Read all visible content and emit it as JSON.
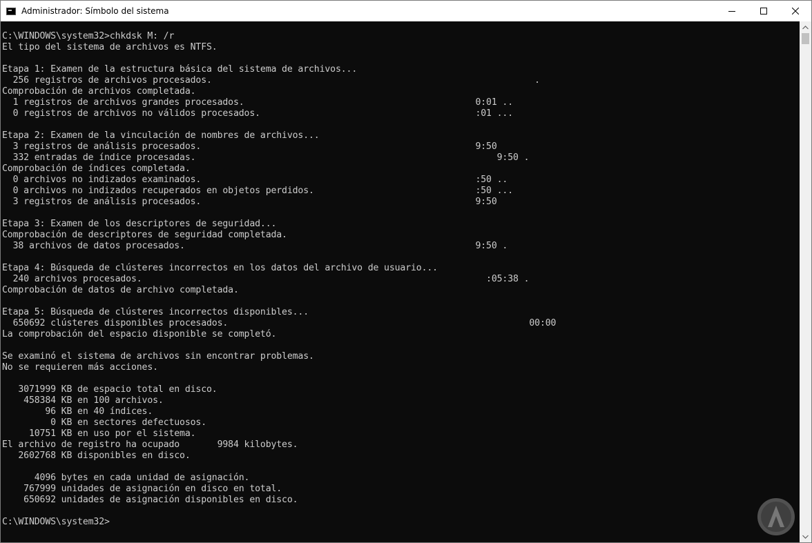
{
  "window": {
    "title": "Administrador: Símbolo del sistema"
  },
  "console": {
    "lines": [
      "C:\\WINDOWS\\system32>chkdsk M: /r",
      "El tipo del sistema de archivos es NTFS.",
      "",
      "Etapa 1: Examen de la estructura básica del sistema de archivos...",
      "  256 registros de archivos procesados.                                                            .",
      "Comprobación de archivos completada.",
      "  1 registros de archivos grandes procesados.                                           0:01 ..",
      "  0 registros de archivos no válidos procesados.                                        :01 ...",
      "",
      "Etapa 2: Examen de la vinculación de nombres de archivos...",
      "  3 registros de análisis procesados.                                                   9:50",
      "  332 entradas de índice procesadas.                                                        9:50 .",
      "Comprobación de índices completada.",
      "  0 archivos no indizados examinados.                                                   :50 ..",
      "  0 archivos no indizados recuperados en objetos perdidos.                              :50 ...",
      "  3 registros de análisis procesados.                                                   9:50",
      "",
      "Etapa 3: Examen de los descriptores de seguridad...",
      "Comprobación de descriptores de seguridad completada.",
      "  38 archivos de datos procesados.                                                      9:50 .",
      "",
      "Etapa 4: Búsqueda de clústeres incorrectos en los datos del archivo de usuario...",
      "  240 archivos procesados.                                                                :05:38 .",
      "Comprobación de datos de archivo completada.",
      "",
      "Etapa 5: Búsqueda de clústeres incorrectos disponibles...",
      "  650692 clústeres disponibles procesados.                                                        00:00",
      "La comprobación del espacio disponible se completó.",
      "",
      "Se examinó el sistema de archivos sin encontrar problemas.",
      "No se requieren más acciones.",
      "",
      "   3071999 KB de espacio total en disco.",
      "    458384 KB en 100 archivos.",
      "        96 KB en 40 índices.",
      "         0 KB en sectores defectuosos.",
      "     10751 KB en uso por el sistema.",
      "El archivo de registro ha ocupado       9984 kilobytes.",
      "   2602768 KB disponibles en disco.",
      "",
      "      4096 bytes en cada unidad de asignación.",
      "    767999 unidades de asignación en disco en total.",
      "    650692 unidades de asignación disponibles en disco.",
      "",
      "C:\\WINDOWS\\system32>"
    ]
  },
  "colors": {
    "console_bg": "#0c0c0c",
    "console_fg": "#cccccc",
    "titlebar_bg": "#ffffff"
  },
  "icons": {
    "app": "cmd-icon",
    "minimize": "minimize-icon",
    "maximize": "maximize-icon",
    "close": "close-icon",
    "scroll_up": "chevron-up-icon",
    "scroll_down": "chevron-down-icon",
    "watermark": "logo-watermark-icon"
  }
}
